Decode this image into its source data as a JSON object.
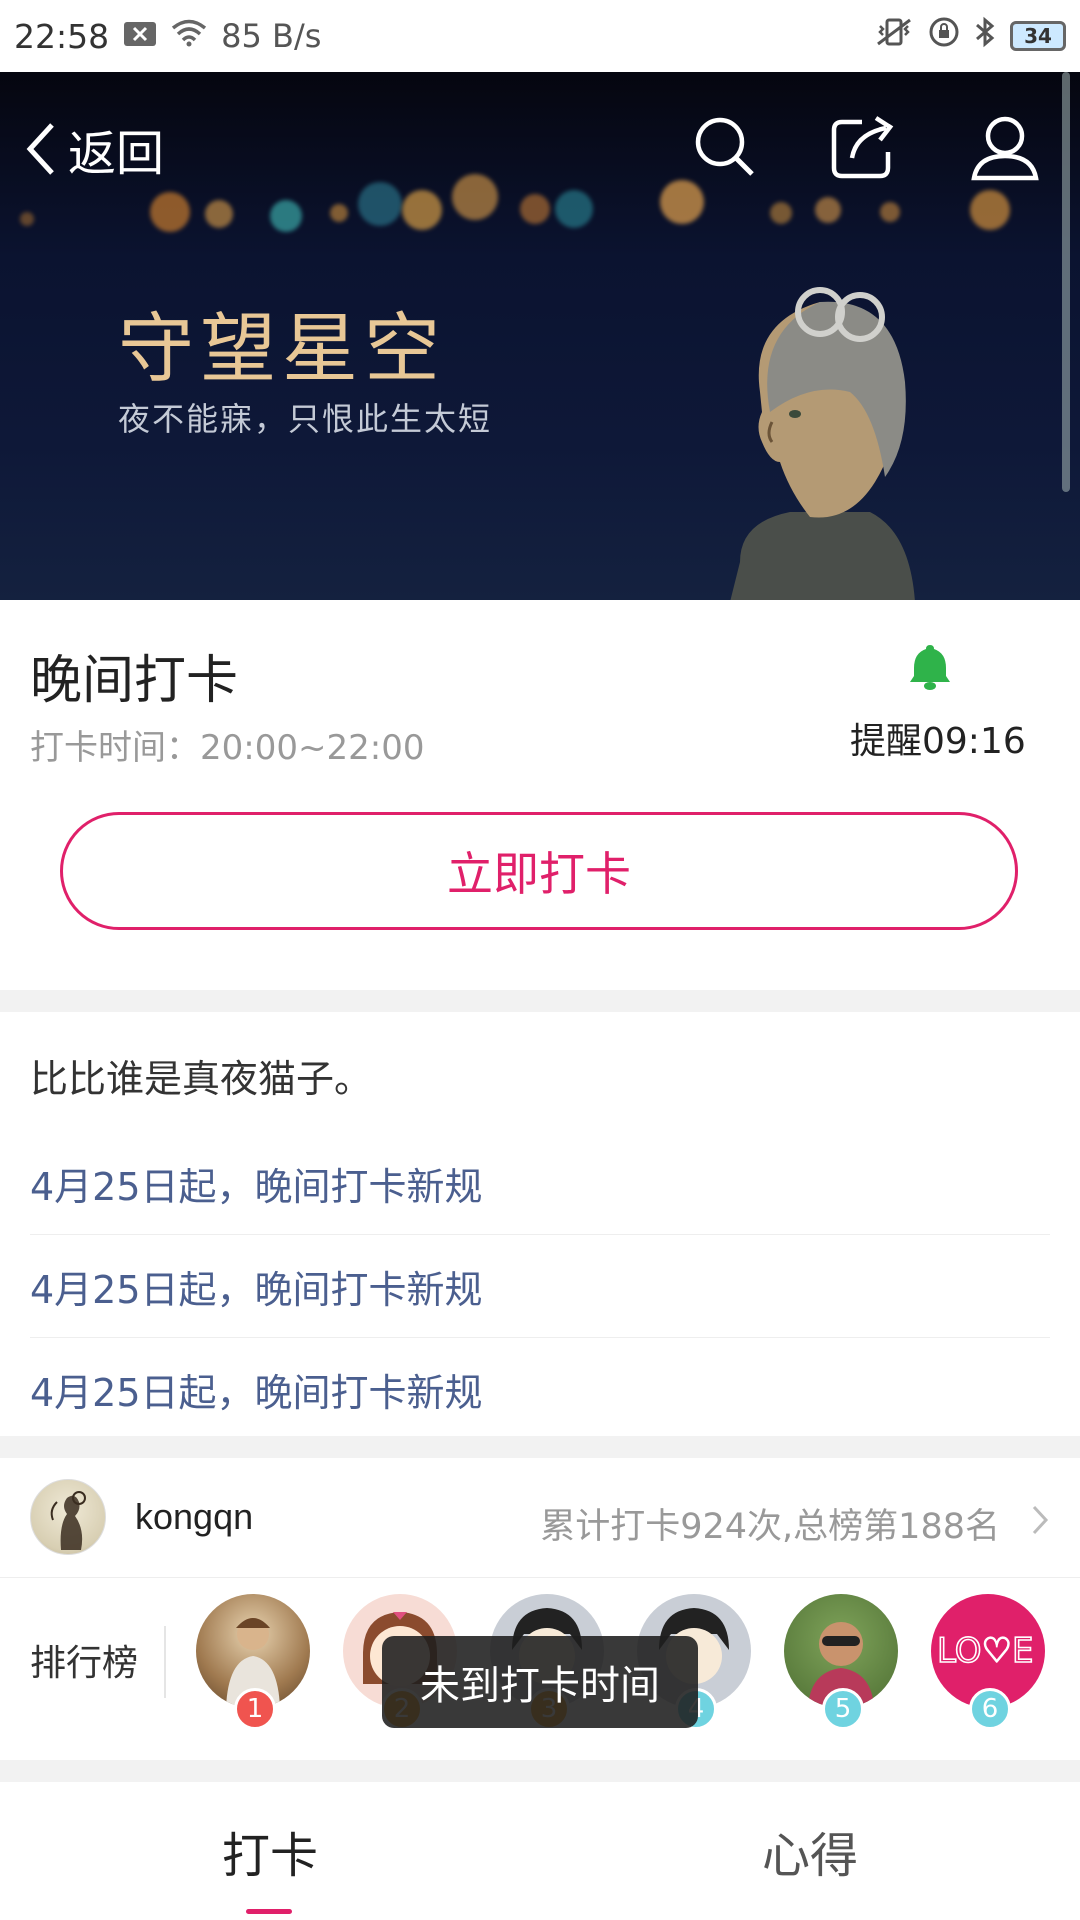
{
  "status_bar": {
    "time": "22:58",
    "network_speed": "85 B/s",
    "battery": "34"
  },
  "hero": {
    "back_label": "返回",
    "title": "守望星空",
    "subtitle": "夜不能寐，只恨此生太短",
    "icons": [
      "search-icon",
      "share-icon",
      "profile-icon"
    ]
  },
  "checkin": {
    "title": "晚间打卡",
    "time_range": "打卡时间：20:00~22:00",
    "reminder": "提醒09:16",
    "reminder_color": "#2fb34a",
    "button_label": "立即打卡",
    "accent_color": "#e0206a"
  },
  "notices": {
    "slogan": "比比谁是真夜猫子。",
    "items": [
      "4月25日起，晚间打卡新规",
      "4月25日起，晚间打卡新规",
      "4月25日起，晚间打卡新规"
    ]
  },
  "user": {
    "name": "kongqn",
    "stats": "累计打卡924次,总榜第188名"
  },
  "ranking": {
    "label": "排行榜",
    "ranks": [
      "1",
      "2",
      "3",
      "4",
      "5",
      "6"
    ],
    "badge_colors": [
      "#f0544f",
      "#f5a623",
      "#f5a623",
      "#6fd3e0",
      "#6fd3e0",
      "#6fd3e0"
    ]
  },
  "toast": "未到打卡时间",
  "tabs": [
    {
      "label": "打卡",
      "active": true
    },
    {
      "label": "心得",
      "active": false
    }
  ]
}
